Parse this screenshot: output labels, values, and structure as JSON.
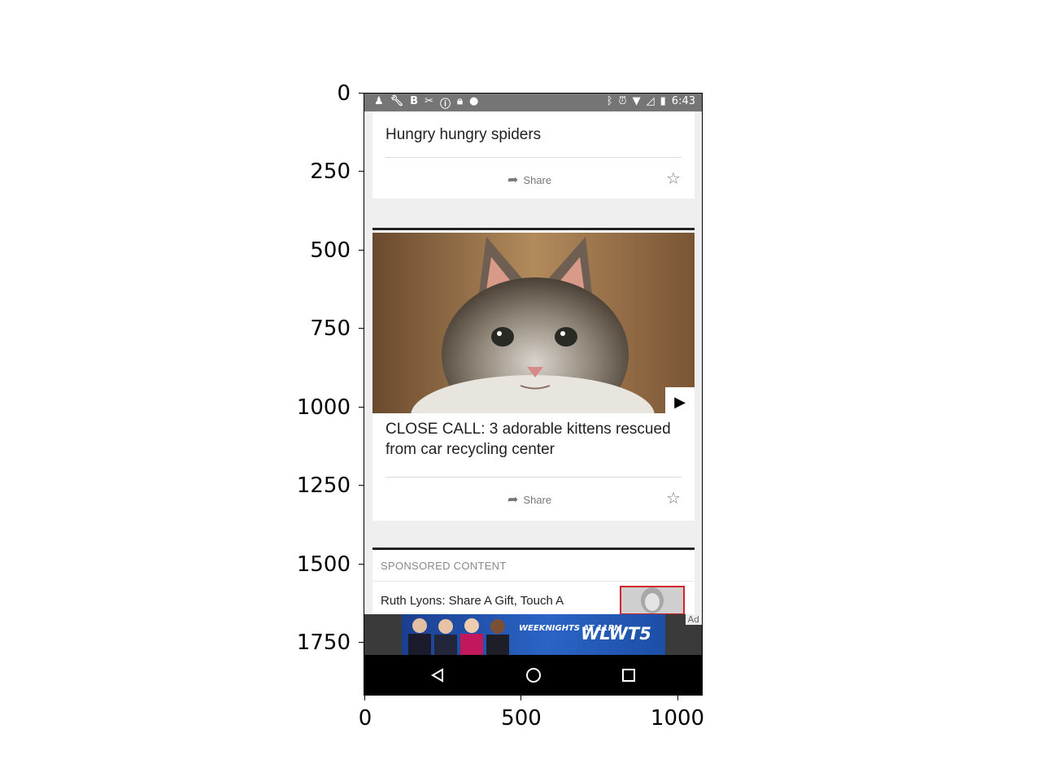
{
  "status_bar": {
    "time": "6:43",
    "left_icons": [
      "person-icon",
      "wrench-icon",
      "b-icon",
      "tools-icon",
      "info-icon",
      "lock-icon",
      "android-icon"
    ],
    "right_icons": [
      "bluetooth-icon",
      "alarm-icon",
      "wifi-icon",
      "no-signal-icon",
      "battery-icon"
    ]
  },
  "cards": [
    {
      "title": "Hungry hungry spiders",
      "share_label": "Share"
    },
    {
      "title": "CLOSE CALL: 3 adorable kittens rescued from car recycling center",
      "share_label": "Share"
    }
  ],
  "sponsored": {
    "label": "SPONSORED CONTENT",
    "title": "Ruth Lyons: Share A Gift, Touch A"
  },
  "ad": {
    "tag": "Ad",
    "line1": "WEEKNIGHTS AT 11PM",
    "brand": "WLWT5"
  },
  "axes": {
    "y_ticks": [
      "0",
      "250",
      "500",
      "750",
      "1000",
      "1250",
      "1500",
      "1750"
    ],
    "x_ticks": [
      "0",
      "500",
      "1000"
    ]
  },
  "colors": {
    "accent_red": "#d3232a",
    "status_bar": "#757575",
    "background": "#efefef"
  }
}
